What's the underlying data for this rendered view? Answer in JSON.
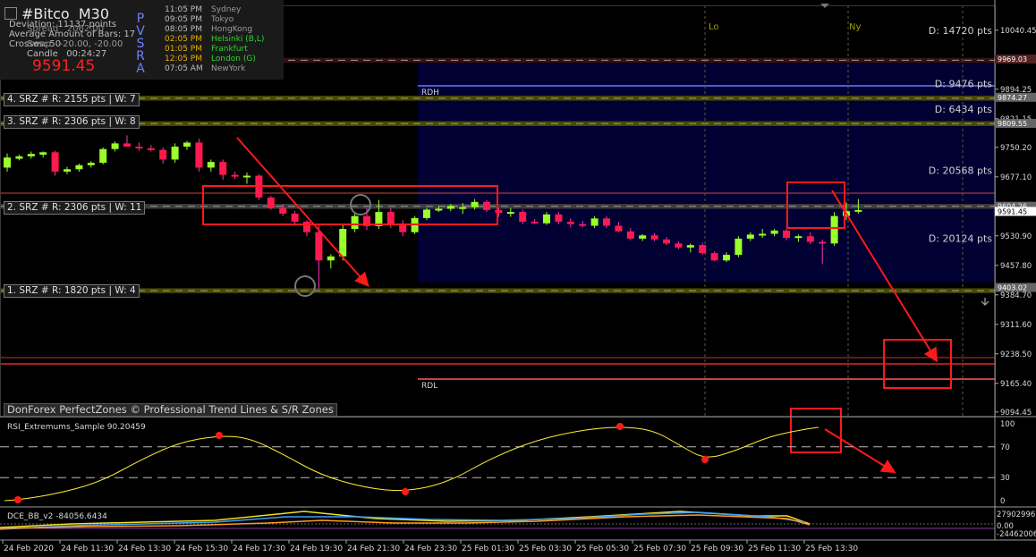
{
  "header": {
    "symbol": "#Bitco",
    "timeframe": "M30",
    "lines": [
      {
        "label": "Deviation",
        "value": "11137 points"
      },
      {
        "label": "Spread",
        "value": "2062.00"
      },
      {
        "label": "Average Amount of Bars",
        "value": "17"
      },
      {
        "label": "Crosses",
        "value": "50"
      },
      {
        "label": "Swap",
        "value": "-20.00, -20.00"
      },
      {
        "label": "Candle",
        "value": "00:24:27"
      }
    ],
    "price": "9591.45",
    "pvsra": [
      "P",
      "V",
      "S",
      "R",
      "A"
    ]
  },
  "sessions": [
    {
      "time": "11:05 PM",
      "name": "Sydney",
      "color": "#9a9a9a"
    },
    {
      "time": "09:05 PM",
      "name": "Tokyo",
      "color": "#9a9a9a"
    },
    {
      "time": "08:05 PM",
      "name": "HongKong",
      "color": "#9a9a9a"
    },
    {
      "time": "02:05 PM",
      "name": "Helsinki  (B,L)",
      "color": "#2fd42f"
    },
    {
      "time": "01:05 PM",
      "name": "Frankfurt",
      "color": "#2fd42f"
    },
    {
      "time": "12:05 PM",
      "name": "London  (G)",
      "color": "#2fd42f"
    },
    {
      "time": "07:05 AM",
      "name": "NewYork",
      "color": "#9a9a9a"
    }
  ],
  "session_time_color": "#e6b000",
  "srz_labels": [
    {
      "text": "4. SRZ # R: 2155 pts | W: 7",
      "price": 9870
    },
    {
      "text": "3. SRZ # R: 2306 pts | W: 8",
      "price": 9813
    },
    {
      "text": "2. SRZ # R: 2306 pts | W: 11",
      "price": 9601
    },
    {
      "text": "1. SRZ # R: 1820 pts | W: 4",
      "price": 9395
    }
  ],
  "distance_labels": [
    {
      "text": "D: 14720 pts",
      "price": 10040
    },
    {
      "text": "D: 9476 pts",
      "price": 9908
    },
    {
      "text": "D: 6434 pts",
      "price": 9845
    },
    {
      "text": "D: 20568 pts",
      "price": 9693
    },
    {
      "text": "D: 20124 pts",
      "price": 9525
    }
  ],
  "session_markers": [
    "Lo",
    "Ny"
  ],
  "range_labels": {
    "high": "RDH",
    "low": "RDL"
  },
  "footer_label": "DonForex PerfectZones © Professional Trend Lines & S/R Zones",
  "chart_data": [
    {
      "type": "candlestick",
      "y_ticks": [
        "10040.45",
        "9894.25",
        "9821.15",
        "9750.20",
        "9677.10",
        "9530.90",
        "9457.80",
        "9384.70",
        "9311.60",
        "9238.50",
        "9165.40",
        "9094.45"
      ],
      "price_flags": [
        "9969.03",
        "9874.27",
        "9809.55",
        "9604.26",
        "9591.45",
        "9403.02"
      ],
      "x_ticks": [
        "24 Feb 2020",
        "24 Feb 11:30",
        "24 Feb 13:30",
        "24 Feb 15:30",
        "24 Feb 17:30",
        "24 Feb 19:30",
        "24 Feb 21:30",
        "24 Feb 23:30",
        "25 Feb 01:30",
        "25 Feb 03:30",
        "25 Feb 05:30",
        "25 Feb 07:30",
        "25 Feb 09:30",
        "25 Feb 11:30",
        "25 Feb 13:30"
      ],
      "ohlc": [
        [
          9700,
          9735,
          9690,
          9725
        ],
        [
          9722,
          9732,
          9718,
          9728
        ],
        [
          9728,
          9740,
          9722,
          9734
        ],
        [
          9732,
          9740,
          9725,
          9738
        ],
        [
          9738,
          9742,
          9680,
          9690
        ],
        [
          9690,
          9702,
          9684,
          9696
        ],
        [
          9696,
          9710,
          9690,
          9706
        ],
        [
          9706,
          9716,
          9700,
          9712
        ],
        [
          9712,
          9750,
          9708,
          9746
        ],
        [
          9746,
          9765,
          9740,
          9760
        ],
        [
          9760,
          9780,
          9752,
          9752
        ],
        [
          9752,
          9762,
          9742,
          9748
        ],
        [
          9748,
          9756,
          9740,
          9744
        ],
        [
          9744,
          9750,
          9710,
          9720
        ],
        [
          9720,
          9760,
          9712,
          9752
        ],
        [
          9752,
          9766,
          9744,
          9762
        ],
        [
          9762,
          9772,
          9690,
          9700
        ],
        [
          9700,
          9720,
          9690,
          9714
        ],
        [
          9714,
          9720,
          9670,
          9682
        ],
        [
          9682,
          9690,
          9672,
          9678
        ],
        [
          9678,
          9688,
          9660,
          9680
        ],
        [
          9680,
          9684,
          9620,
          9626
        ],
        [
          9626,
          9630,
          9596,
          9600
        ],
        [
          9600,
          9610,
          9580,
          9586
        ],
        [
          9586,
          9592,
          9556,
          9566
        ],
        [
          9566,
          9570,
          9530,
          9540
        ],
        [
          9540,
          9560,
          9400,
          9470
        ],
        [
          9470,
          9485,
          9450,
          9480
        ],
        [
          9480,
          9560,
          9470,
          9548
        ],
        [
          9548,
          9590,
          9540,
          9580
        ],
        [
          9580,
          9600,
          9545,
          9555
        ],
        [
          9555,
          9620,
          9548,
          9590
        ],
        [
          9590,
          9600,
          9550,
          9560
        ],
        [
          9560,
          9570,
          9530,
          9540
        ],
        [
          9540,
          9580,
          9535,
          9575
        ],
        [
          9575,
          9600,
          9570,
          9596
        ],
        [
          9596,
          9605,
          9590,
          9598
        ],
        [
          9598,
          9610,
          9592,
          9605
        ],
        [
          9600,
          9612,
          9585,
          9602
        ],
        [
          9602,
          9622,
          9596,
          9615
        ],
        [
          9615,
          9620,
          9590,
          9595
        ],
        [
          9595,
          9600,
          9578,
          9588
        ],
        [
          9588,
          9600,
          9578,
          9590
        ],
        [
          9590,
          9596,
          9560,
          9566
        ],
        [
          9566,
          9572,
          9560,
          9562
        ],
        [
          9562,
          9590,
          9558,
          9584
        ],
        [
          9584,
          9590,
          9560,
          9566
        ],
        [
          9566,
          9574,
          9552,
          9560
        ],
        [
          9560,
          9568,
          9552,
          9556
        ],
        [
          9556,
          9580,
          9550,
          9574
        ],
        [
          9574,
          9580,
          9550,
          9556
        ],
        [
          9556,
          9565,
          9540,
          9542
        ],
        [
          9542,
          9550,
          9520,
          9524
        ],
        [
          9524,
          9535,
          9518,
          9532
        ],
        [
          9532,
          9538,
          9518,
          9522
        ],
        [
          9522,
          9528,
          9508,
          9512
        ],
        [
          9512,
          9518,
          9498,
          9502
        ],
        [
          9502,
          9512,
          9490,
          9508
        ],
        [
          9508,
          9514,
          9484,
          9488
        ],
        [
          9488,
          9492,
          9468,
          9470
        ],
        [
          9470,
          9490,
          9466,
          9484
        ],
        [
          9484,
          9530,
          9478,
          9524
        ],
        [
          9524,
          9540,
          9518,
          9534
        ],
        [
          9534,
          9548,
          9526,
          9536
        ],
        [
          9536,
          9548,
          9530,
          9544
        ],
        [
          9544,
          9548,
          9520,
          9526
        ],
        [
          9526,
          9534,
          9516,
          9530
        ],
        [
          9530,
          9540,
          9510,
          9516
        ],
        [
          9516,
          9522,
          9462,
          9512
        ],
        [
          9512,
          9590,
          9506,
          9580
        ],
        [
          9580,
          9614,
          9570,
          9592
        ],
        [
          9592,
          9622,
          9586,
          9595
        ]
      ]
    },
    {
      "type": "line",
      "title": "RSI_Extremums_Sample 90.20459",
      "y_ticks": [
        "100",
        "70",
        "30",
        "0"
      ],
      "ylim": [
        0,
        100
      ]
    },
    {
      "type": "line",
      "title": "DCE_BB_v2 -84056.6434",
      "y_ticks": [
        "27902996",
        "0.00",
        "-24462006"
      ]
    }
  ]
}
